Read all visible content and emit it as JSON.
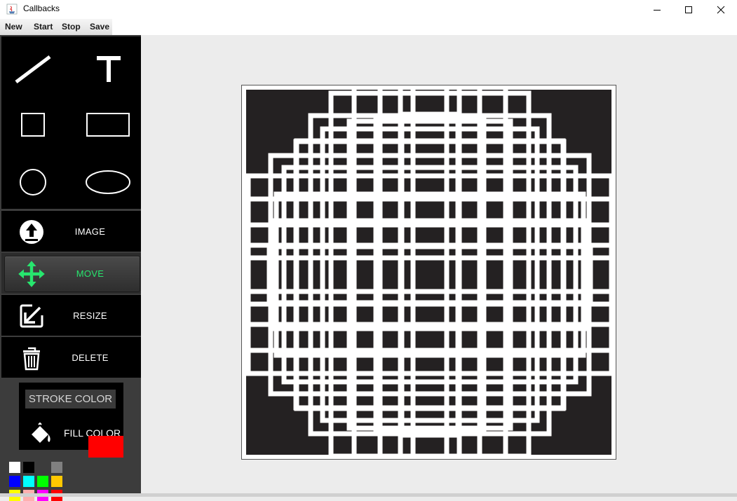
{
  "window": {
    "title": "Callbacks"
  },
  "menu": {
    "items": [
      "New",
      "Start",
      "Stop",
      "Save"
    ]
  },
  "tools": {
    "actions": [
      {
        "id": "image",
        "label": "IMAGE",
        "active": false,
        "icon": "upload-icon"
      },
      {
        "id": "move",
        "label": "MOVE",
        "active": true,
        "icon": "move-arrows-icon"
      },
      {
        "id": "resize",
        "label": "RESIZE",
        "active": false,
        "icon": "resize-icon"
      },
      {
        "id": "delete",
        "label": "DELETE",
        "active": false,
        "icon": "trash-icon"
      }
    ]
  },
  "colors": {
    "stroke_label": "STROKE COLOR",
    "fill_label": "FILL COLOR",
    "palette": [
      "#ffffff",
      "#000000",
      "#3c3c3c",
      "#808080",
      "#0000ff",
      "#00ffff",
      "#00ff00",
      "#ffc800",
      "#ffff00",
      "#ffafaf",
      "#ff00ff",
      "#ff0000"
    ],
    "current": "#ff0000",
    "move_accent": "#27e66e"
  }
}
